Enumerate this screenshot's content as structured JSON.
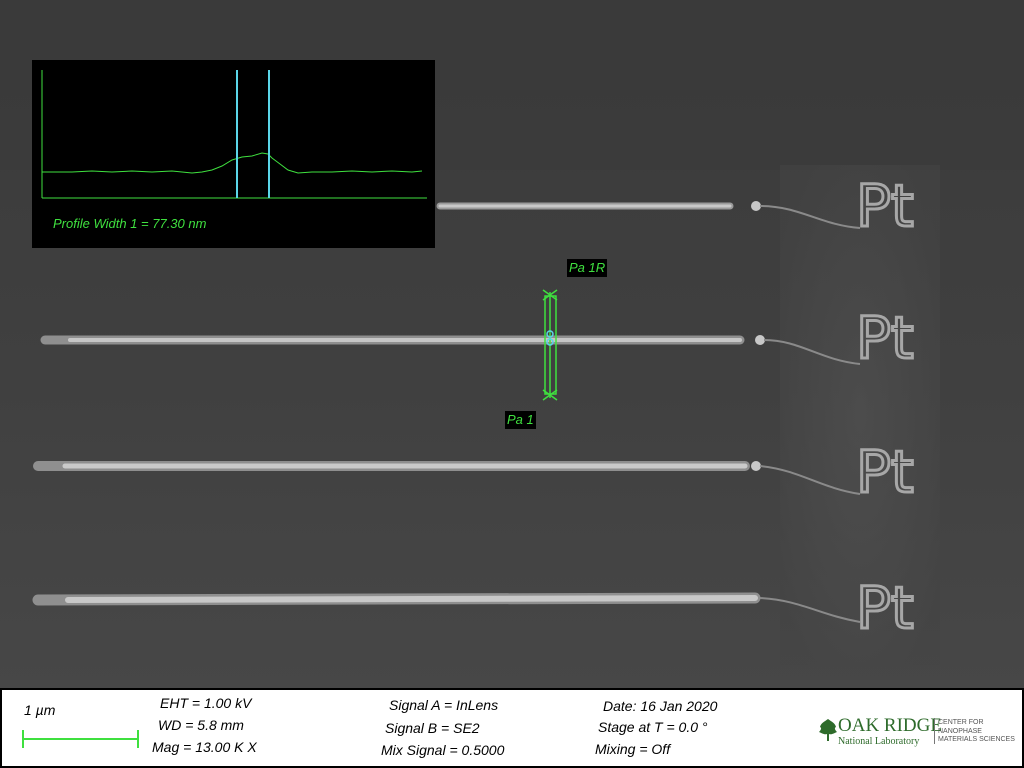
{
  "profile": {
    "readout": "Profile Width 1 = 77.30 nm",
    "cursor_color": "#5bd6e8",
    "trace_color": "#3fe03f"
  },
  "image_text": {
    "letters": [
      "Pt",
      "Pt",
      "Pt",
      "Pt"
    ]
  },
  "markers": {
    "start_tag": "Pa 1",
    "end_tag": "Pa 1R",
    "color": "#3fe03f"
  },
  "databar": {
    "scale_label": "1 µm",
    "eht": "EHT =  1.00 kV",
    "wd": "WD =  5.8 mm",
    "mag": "Mag =  13.00 K X",
    "signal_a": "Signal A = InLens",
    "signal_b": "Signal B = SE2",
    "mix_signal": "Mix Signal = 0.5000",
    "date": "Date: 16 Jan 2020",
    "stage": "Stage at T =   0.0 °",
    "mixing": "Mixing = Off"
  },
  "logo": {
    "name": "OAK RIDGE",
    "subtitle": "National Laboratory",
    "center": "CENTER FOR NANOPHASE MATERIALS SCIENCES"
  }
}
